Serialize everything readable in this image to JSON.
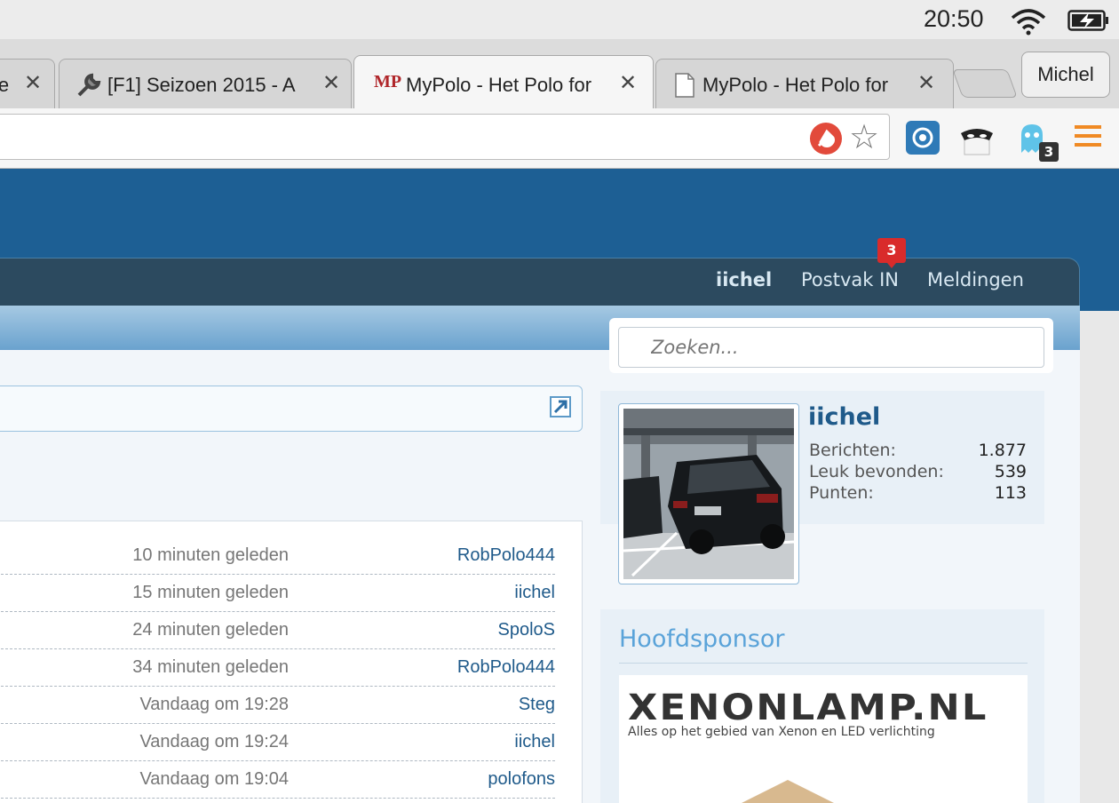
{
  "menubar": {
    "clock": "20:50"
  },
  "browser": {
    "tabs": [
      {
        "title": "ie",
        "close": "✕"
      },
      {
        "title": "[F1] Seizoen 2015 - A",
        "close": "✕"
      },
      {
        "title": "MyPolo - Het Polo for",
        "close": "✕",
        "favicon": "MP",
        "active": true
      },
      {
        "title": "MyPolo - Het Polo for",
        "close": "✕"
      }
    ],
    "profile": "Michel",
    "extension_badge": "3"
  },
  "nav": {
    "username": "iichel",
    "inbox": "Postvak IN",
    "inbox_badge": "3",
    "notifications": "Meldingen"
  },
  "search": {
    "placeholder": "Zoeken..."
  },
  "recent": [
    {
      "time": "10 minuten geleden",
      "user": "RobPolo444"
    },
    {
      "time": "15 minuten geleden",
      "user": "iichel"
    },
    {
      "time": "24 minuten geleden",
      "user": "SpoloS"
    },
    {
      "time": "34 minuten geleden",
      "user": "RobPolo444"
    },
    {
      "time": "Vandaag om 19:28",
      "user": "Steg"
    },
    {
      "time": "Vandaag om 19:24",
      "user": "iichel"
    },
    {
      "time": "Vandaag om 19:04",
      "user": "polofons"
    }
  ],
  "profile": {
    "name": "iichel",
    "stats": [
      {
        "label": "Berichten:",
        "value": "1.877"
      },
      {
        "label": "Leuk bevonden:",
        "value": "539"
      },
      {
        "label": "Punten:",
        "value": "113"
      }
    ]
  },
  "sponsor": {
    "title": "Hoofdsponsor",
    "logo": "XENONLAMP.NL",
    "tagline": "Alles op het gebied van Xenon en LED verlichting"
  },
  "colors": {
    "header": "#1d5f94",
    "navbar": "#2c4a5f",
    "link": "#1f5a8a",
    "badge": "#d92b2b"
  }
}
